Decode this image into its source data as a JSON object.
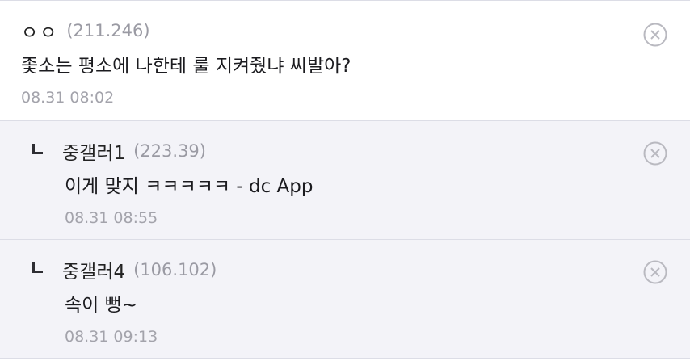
{
  "comments": [
    {
      "nickname": "ㅇㅇ",
      "ip": "(211.246)",
      "text": "좇소는 평소에 나한테 룰 지켜줬냐 씨발아?",
      "time": "08.31 08:02"
    }
  ],
  "replies": [
    {
      "nickname": "중갤러1",
      "ip": "(223.39)",
      "text": "이게 맞지 ㅋㅋㅋㅋㅋ - dc App",
      "time": "08.31 08:55"
    },
    {
      "nickname": "중갤러4",
      "ip": "(106.102)",
      "text": "속이 뻥~",
      "time": "08.31 09:13"
    }
  ],
  "colors": {
    "nickname": "#222222",
    "ip": "#9a9aa3",
    "time": "#a3a3ab",
    "reply_background": "#f3f3f8",
    "divider": "#dcdde6",
    "delete_icon": "#b9b9c0"
  },
  "icons": {
    "delete": "circle-x-icon",
    "reply_marker": "reply-corner-icon"
  }
}
